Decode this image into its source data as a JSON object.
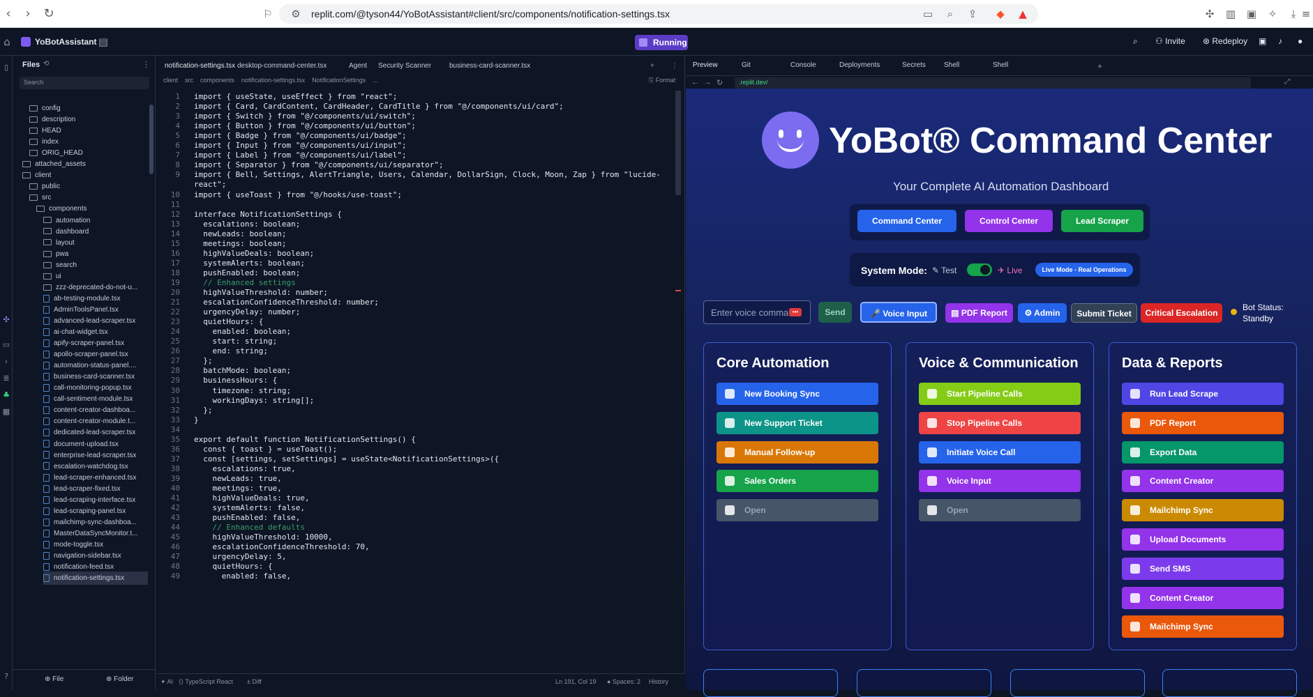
{
  "browser": {
    "url": "replit.com/@tyson44/YoBotAssistant#client/src/components/notification-settings.tsx"
  },
  "topbar": {
    "project_name": "YoBotAssistant",
    "run_label": "Running",
    "invite_label": "Invite",
    "redeploy_label": "Redeploy"
  },
  "files": {
    "title": "Files",
    "search_placeholder": "Search",
    "items": [
      {
        "label": "config",
        "type": "folder",
        "indent": 1
      },
      {
        "label": "description",
        "type": "folder",
        "indent": 1
      },
      {
        "label": "HEAD",
        "type": "folder",
        "indent": 1
      },
      {
        "label": "index",
        "type": "folder",
        "indent": 1
      },
      {
        "label": "ORIG_HEAD",
        "type": "folder",
        "indent": 1
      },
      {
        "label": "attached_assets",
        "type": "folder",
        "indent": 0
      },
      {
        "label": "client",
        "type": "folder",
        "indent": 0
      },
      {
        "label": "public",
        "type": "folder",
        "indent": 1
      },
      {
        "label": "src",
        "type": "folder",
        "indent": 1
      },
      {
        "label": "components",
        "type": "folder",
        "indent": 2
      },
      {
        "label": "automation",
        "type": "folder",
        "indent": 3
      },
      {
        "label": "dashboard",
        "type": "folder",
        "indent": 3
      },
      {
        "label": "layout",
        "type": "folder",
        "indent": 3
      },
      {
        "label": "pwa",
        "type": "folder",
        "indent": 3
      },
      {
        "label": "search",
        "type": "folder",
        "indent": 3
      },
      {
        "label": "ui",
        "type": "folder",
        "indent": 3
      },
      {
        "label": "zzz-deprecated-do-not-u...",
        "type": "folder",
        "indent": 3
      },
      {
        "label": "ab-testing-module.tsx",
        "type": "file",
        "indent": 3
      },
      {
        "label": "AdminToolsPanel.tsx",
        "type": "file",
        "indent": 3
      },
      {
        "label": "advanced-lead-scraper.tsx",
        "type": "file",
        "indent": 3
      },
      {
        "label": "ai-chat-widget.tsx",
        "type": "file",
        "indent": 3
      },
      {
        "label": "apify-scraper-panel.tsx",
        "type": "file",
        "indent": 3
      },
      {
        "label": "apollo-scraper-panel.tsx",
        "type": "file",
        "indent": 3
      },
      {
        "label": "automation-status-panel....",
        "type": "file",
        "indent": 3
      },
      {
        "label": "business-card-scanner.tsx",
        "type": "file",
        "indent": 3
      },
      {
        "label": "call-monitoring-popup.tsx",
        "type": "file",
        "indent": 3
      },
      {
        "label": "call-sentiment-module.tsx",
        "type": "file",
        "indent": 3
      },
      {
        "label": "content-creator-dashboa...",
        "type": "file",
        "indent": 3
      },
      {
        "label": "content-creator-module.t...",
        "type": "file",
        "indent": 3
      },
      {
        "label": "dedicated-lead-scraper.tsx",
        "type": "file",
        "indent": 3
      },
      {
        "label": "document-upload.tsx",
        "type": "file",
        "indent": 3
      },
      {
        "label": "enterprise-lead-scraper.tsx",
        "type": "file",
        "indent": 3
      },
      {
        "label": "escalation-watchdog.tsx",
        "type": "file",
        "indent": 3
      },
      {
        "label": "lead-scraper-enhanced.tsx",
        "type": "file",
        "indent": 3
      },
      {
        "label": "lead-scraper-fixed.tsx",
        "type": "file",
        "indent": 3
      },
      {
        "label": "lead-scraping-interface.tsx",
        "type": "file",
        "indent": 3
      },
      {
        "label": "lead-scraping-panel.tsx",
        "type": "file",
        "indent": 3
      },
      {
        "label": "mailchimp-sync-dashboa...",
        "type": "file",
        "indent": 3
      },
      {
        "label": "MasterDataSyncMonitor.t...",
        "type": "file",
        "indent": 3
      },
      {
        "label": "mode-toggle.tsx",
        "type": "file",
        "indent": 3
      },
      {
        "label": "navigation-sidebar.tsx",
        "type": "file",
        "indent": 3
      },
      {
        "label": "notification-feed.tsx",
        "type": "file",
        "indent": 3
      },
      {
        "label": "notification-settings.tsx",
        "type": "file",
        "indent": 3
      }
    ],
    "new_file_label": "File",
    "new_folder_label": "Folder"
  },
  "editor": {
    "tabs": [
      "notification-settings.tsx",
      "desktop-command-center.tsx",
      "Agent",
      "Security Scanner",
      "business-card-scanner.tsx"
    ],
    "breadcrumb": [
      "client",
      "src",
      "components",
      "notification-settings.tsx",
      "NotificationSettings",
      "..."
    ],
    "format_label": "Format",
    "lines": [
      "import { useState, useEffect } from \"react\";",
      "import { Card, CardContent, CardHeader, CardTitle } from \"@/components/ui/card\";",
      "import { Switch } from \"@/components/ui/switch\";",
      "import { Button } from \"@/components/ui/button\";",
      "import { Badge } from \"@/components/ui/badge\";",
      "import { Input } from \"@/components/ui/input\";",
      "import { Label } from \"@/components/ui/label\";",
      "import { Separator } from \"@/components/ui/separator\";",
      "import { Bell, Settings, AlertTriangle, Users, Calendar, DollarSign, Clock, Moon, Zap } from \"lucide-",
      "react\";",
      "import { useToast } from \"@/hooks/use-toast\";",
      "",
      "interface NotificationSettings {",
      "  escalations: boolean;",
      "  newLeads: boolean;",
      "  meetings: boolean;",
      "  highValueDeals: boolean;",
      "  systemAlerts: boolean;",
      "  pushEnabled: boolean;",
      "  // Enhanced settings",
      "  highValueThreshold: number;",
      "  escalationConfidenceThreshold: number;",
      "  urgencyDelay: number;",
      "  quietHours: {",
      "    enabled: boolean;",
      "    start: string;",
      "    end: string;",
      "  };",
      "  batchMode: boolean;",
      "  businessHours: {",
      "    timezone: string;",
      "    workingDays: string[];",
      "  };",
      "}",
      "",
      "export default function NotificationSettings() {",
      "  const { toast } = useToast();",
      "  const [settings, setSettings] = useState<NotificationSettings>({",
      "    escalations: true,",
      "    newLeads: true,",
      "    meetings: true,",
      "    highValueDeals: true,",
      "    systemAlerts: false,",
      "    pushEnabled: false,",
      "    // Enhanced defaults",
      "    highValueThreshold: 10000,",
      "    escalationConfidenceThreshold: 70,",
      "    urgencyDelay: 5,",
      "    quietHours: {",
      "      enabled: false,"
    ],
    "line_numbers": [
      "1",
      "2",
      "3",
      "4",
      "5",
      "6",
      "7",
      "8",
      "9",
      "",
      "10",
      "11",
      "12",
      "13",
      "14",
      "15",
      "16",
      "17",
      "18",
      "19",
      "20",
      "21",
      "22",
      "23",
      "24",
      "25",
      "26",
      "27",
      "28",
      "29",
      "30",
      "31",
      "32",
      "33",
      "34",
      "35",
      "36",
      "37",
      "38",
      "39",
      "40",
      "41",
      "42",
      "43",
      "44",
      "45",
      "46",
      "47",
      "48",
      "49"
    ]
  },
  "status": {
    "ai_label": "AI",
    "lang_label": "TypeScript React",
    "diff_label": "Diff",
    "position": "Ln 191, Col 19",
    "spaces": "Spaces: 2",
    "history": "History"
  },
  "rightpanel": {
    "tabs": [
      "Preview",
      "Git",
      "Console",
      "Deployments",
      "Secrets",
      "Shell",
      "Shell"
    ],
    "url": ".replit.dev/"
  },
  "app": {
    "title": "YoBot® Command Center",
    "subtitle": "Your Complete AI Automation Dashboard",
    "nav": [
      {
        "label": "Command Center",
        "color": "#2563eb"
      },
      {
        "label": "Control Center",
        "color": "#9333ea"
      },
      {
        "label": "Lead Scraper",
        "color": "#16a34a"
      }
    ],
    "mode_label": "System Mode:",
    "mode_test": "Test",
    "mode_live": "Live",
    "mode_badge": "Live Mode - Real Operations",
    "voice_placeholder": "Enter voice comma",
    "send_label": "Send",
    "voice_input_label": "Voice Input",
    "pdf_label": "PDF Report",
    "admin_label": "Admin",
    "submit_ticket_label": "Submit Ticket",
    "critical_label": "Critical Escalation",
    "bot_status": "Bot Status:",
    "bot_state": "Standby",
    "panels": [
      {
        "title": "Core Automation",
        "buttons": [
          {
            "label": "New Booking Sync",
            "color": "#2563eb"
          },
          {
            "label": "New Support Ticket",
            "color": "#0d9488"
          },
          {
            "label": "Manual Follow-up",
            "color": "#d97706"
          },
          {
            "label": "Sales Orders",
            "color": "#16a34a"
          },
          {
            "label": "Open",
            "color": "#475569"
          }
        ]
      },
      {
        "title": "Voice & Communication",
        "buttons": [
          {
            "label": "Start Pipeline Calls",
            "color": "#84cc16"
          },
          {
            "label": "Stop Pipeline Calls",
            "color": "#ef4444"
          },
          {
            "label": "Initiate Voice Call",
            "color": "#2563eb"
          },
          {
            "label": "Voice Input",
            "color": "#9333ea"
          },
          {
            "label": "Open",
            "color": "#475569"
          }
        ]
      },
      {
        "title": "Data & Reports",
        "buttons": [
          {
            "label": "Run Lead Scrape",
            "color": "#4f46e5"
          },
          {
            "label": "PDF Report",
            "color": "#ea580c"
          },
          {
            "label": "Export Data",
            "color": "#059669"
          },
          {
            "label": "Content Creator",
            "color": "#9333ea"
          },
          {
            "label": "Mailchimp Sync",
            "color": "#ca8a04"
          },
          {
            "label": "Upload Documents",
            "color": "#9333ea"
          },
          {
            "label": "Send SMS",
            "color": "#7c3aed"
          },
          {
            "label": "Content Creator",
            "color": "#9333ea"
          },
          {
            "label": "Mailchimp Sync",
            "color": "#ea580c"
          }
        ]
      }
    ]
  }
}
